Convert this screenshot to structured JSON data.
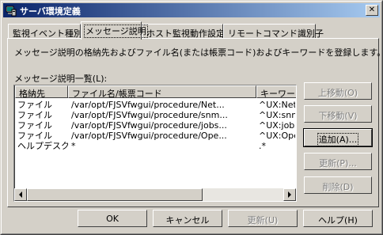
{
  "window": {
    "title": "サーバ環境定義"
  },
  "tabs": [
    {
      "label": "監視イベント種別"
    },
    {
      "label": "メッセージ説明"
    },
    {
      "label": "ホスト監視動作設定"
    },
    {
      "label": "リモートコマンド識別子"
    }
  ],
  "panel": {
    "description": "メッセージ説明の格納先およびファイル名(または帳票コード)およびキーワードを登録します。",
    "list_label": "メッセージ説明一覧(L):"
  },
  "table": {
    "columns": [
      "格納先",
      "ファイル名/帳票コード",
      "キーワード"
    ],
    "rows": [
      [
        "ファイル",
        "/var/opt/FJSVfwgui/procedure/Net...",
        "^UX:NetW..."
      ],
      [
        "ファイル",
        "/var/opt/FJSVfwgui/procedure/snm...",
        "^UX:snmp..."
      ],
      [
        "ファイル",
        "/var/opt/FJSVfwgui/procedure/jobs...",
        "^UX:jobsc..."
      ],
      [
        "ファイル",
        "/var/opt/FJSVfwgui/procedure/Ope...",
        "^UX:Open..."
      ],
      [
        "ヘルプデスク",
        "*",
        ".*"
      ]
    ]
  },
  "side_buttons": {
    "move_up": "上移動(O)",
    "move_down": "下移動(V)",
    "add": "追加(A)...",
    "update": "更新(P)...",
    "delete": "削除(D)"
  },
  "bottom_buttons": {
    "ok": "OK",
    "cancel": "キャンセル",
    "update": "更新(U)",
    "help": "ヘルプ(H)"
  },
  "colors": {
    "title_start": "#0a246a",
    "title_end": "#a6caf0",
    "face": "#d4d0c8"
  },
  "icons": {
    "app": "server-icon",
    "close": "close-icon"
  }
}
